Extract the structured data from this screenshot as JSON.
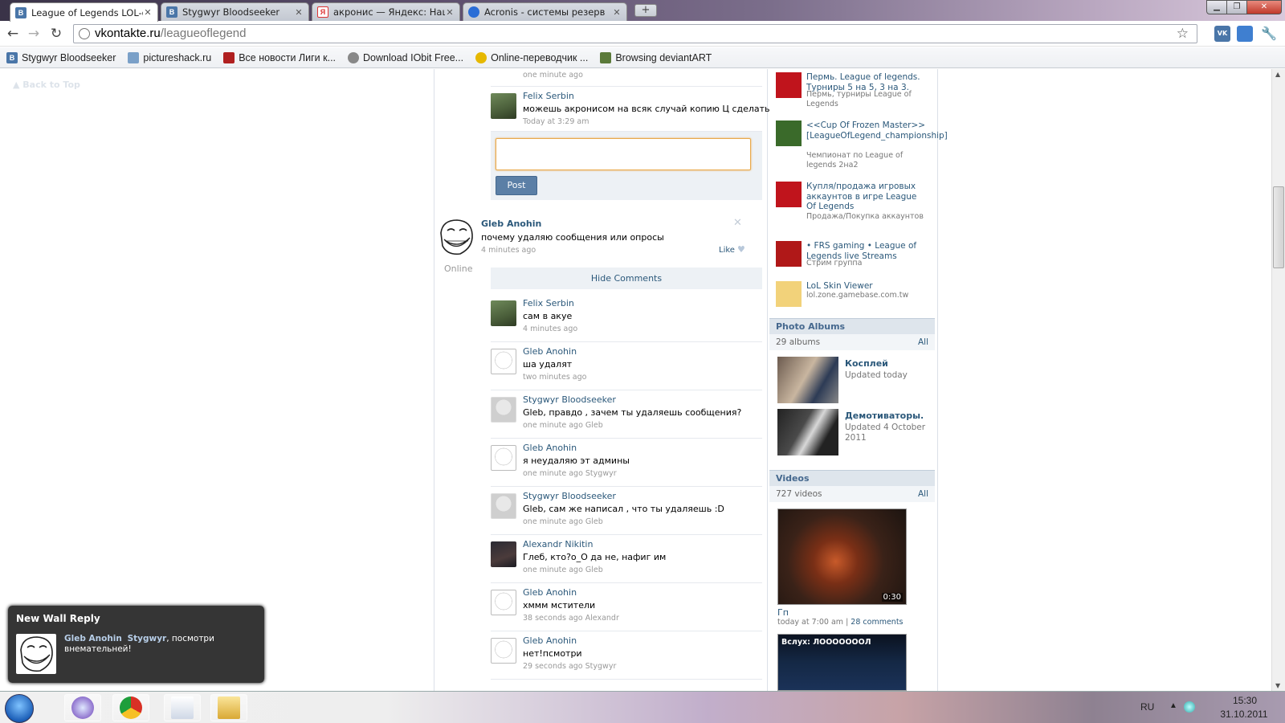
{
  "browser": {
    "tabs": [
      {
        "title": "League of Legends LOL-gar",
        "favicon": "В",
        "color": "#4a76a8",
        "active": true
      },
      {
        "title": "Stygwyr Bloodseeker",
        "favicon": "В",
        "color": "#4a76a8",
        "active": false
      },
      {
        "title": "акронис — Яндекс: Нашл",
        "favicon": "Я",
        "color": "#d33",
        "active": false
      },
      {
        "title": "Acronis - системы резерв",
        "favicon": "",
        "color": "#2a6dd6",
        "active": false
      }
    ],
    "new_tab": "+",
    "url_host": "vkontakte.ru",
    "url_path": "/leagueoflegend",
    "bookmarks": [
      {
        "label": "Stygwyr Bloodseeker",
        "icon": "vk-icon",
        "color": "#4a76a8",
        "glyph": "В"
      },
      {
        "label": "pictureshack.ru",
        "icon": "pictureshack-icon",
        "color": "#7aa0c8",
        "glyph": ""
      },
      {
        "label": "Все новости Лиги к...",
        "icon": "news-icon",
        "color": "#b02020",
        "glyph": ""
      },
      {
        "label": "Download IObit Free...",
        "icon": "iobit-icon",
        "color": "#888",
        "glyph": ""
      },
      {
        "label": "Online-переводчик ...",
        "icon": "translator-icon",
        "color": "#e6b800",
        "glyph": ""
      },
      {
        "label": "Browsing deviantART",
        "icon": "deviantart-icon",
        "color": "#5b7a3a",
        "glyph": ""
      }
    ]
  },
  "page": {
    "back_to_top": "Back to Top",
    "prev_comments": [
      {
        "name": "",
        "text": "",
        "meta": "one minute ago",
        "avatar": "av-felix"
      },
      {
        "name": "Felix Serbin",
        "text": "можешь акронисом на всяк случай копию Ц сделать",
        "meta": "Today at 3:29 am",
        "avatar": "av-felix"
      }
    ],
    "post_button": "Post",
    "post": {
      "author": "Gleb Anohin",
      "online": "Online",
      "text": "почему удаляю сообщения или опросы",
      "time": "4 minutes ago",
      "like": "Like",
      "hide_comments": "Hide Comments"
    },
    "comments": [
      {
        "name": "Felix Serbin",
        "text": "сам в акуе",
        "meta": "4 minutes ago",
        "avatar": "av-felix"
      },
      {
        "name": "Gleb Anohin",
        "text": "ша удалят",
        "meta": "two minutes ago",
        "avatar": "av-troll"
      },
      {
        "name": "Stygwyr Bloodseeker",
        "text": "Gleb, правдо , зачем ты удаляешь сообщения?",
        "meta": "one minute ago Gleb",
        "avatar": "av-styg"
      },
      {
        "name": "Gleb Anohin",
        "text": "я неудаляю эт админы",
        "meta": "one minute ago Stygwyr",
        "avatar": "av-troll"
      },
      {
        "name": "Stygwyr Bloodseeker",
        "text": "Gleb, сам же написал , что ты удаляешь :D",
        "meta": "one minute ago Gleb",
        "avatar": "av-styg"
      },
      {
        "name": "Alexandr Nikitin",
        "text": "Глеб, кто?о_О да не, нафиг им",
        "meta": "one minute ago Gleb",
        "avatar": "av-alex"
      },
      {
        "name": "Gleb Anohin",
        "text": "хммм мстители",
        "meta": "38 seconds ago Alexandr",
        "avatar": "av-troll"
      },
      {
        "name": "Gleb Anohin",
        "text": "нет!псмотри",
        "meta": "29 seconds ago Stygwyr",
        "avatar": "av-troll"
      }
    ]
  },
  "sidebar": {
    "groups": [
      {
        "name": "Пермь. League of legends. Турниры 5 на 5, 3 на 3.",
        "sub": "Пермь, турниры League of Legends",
        "avatar_color": "#c0141c"
      },
      {
        "name": "<<Cup Of Frozen Master>> [LeagueOfLegend_championship]",
        "sub": "Чемпионат по League of legends 2на2",
        "avatar_color": "#3a6a2a"
      },
      {
        "name": "Купля/продажа игровых аккаунтов в игре League Of Legends",
        "sub": "Продажа/Покупка аккаунтов",
        "avatar_color": "#c0141c"
      },
      {
        "name": "• FRS gaming • League of Legends live Streams",
        "sub": "Стрим группа",
        "avatar_color": "#b01818"
      },
      {
        "name": "LoL Skin Viewer",
        "sub": "lol.zone.gamebase.com.tw",
        "avatar_color": "#f2d27a"
      }
    ],
    "photo_albums": {
      "title": "Photo Albums",
      "count": "29 albums",
      "all": "All",
      "items": [
        {
          "title": "Косплей",
          "updated": "Updated today"
        },
        {
          "title": "Демотиваторы.",
          "updated": "Updated 4 October 2011"
        }
      ]
    },
    "videos": {
      "title": "Videos",
      "count": "727 videos",
      "all": "All",
      "first": {
        "title": "Гп",
        "time": "today at 7:00 am",
        "sep": "|",
        "comments": "28 comments",
        "duration": "0:30"
      },
      "second_caption": "Вслух: ЛОООООООЛ"
    }
  },
  "notification": {
    "title": "New Wall Reply",
    "author": "Gleb Anohin",
    "mention": "Stygwyr",
    "message": ", посмотри внемательней!"
  },
  "taskbar": {
    "lang": "RU",
    "time": "15:30",
    "date": "31.10.2011"
  }
}
